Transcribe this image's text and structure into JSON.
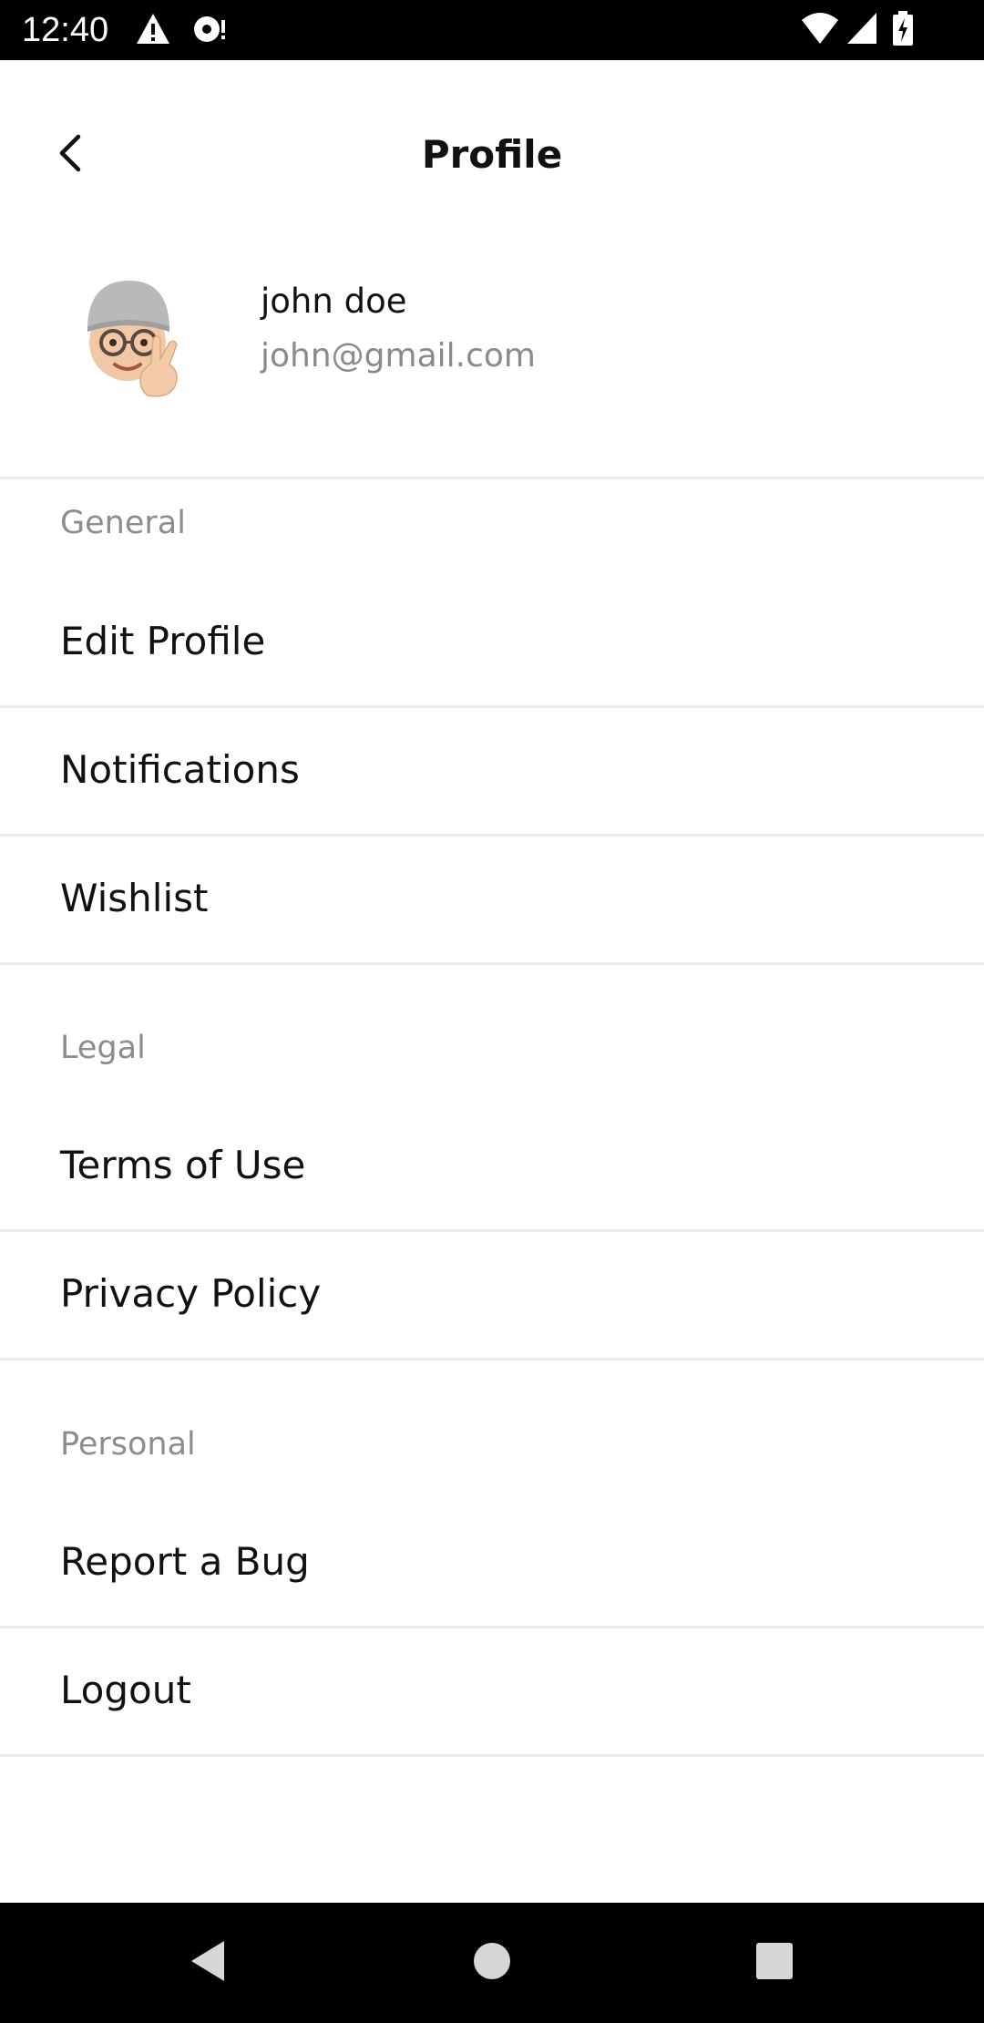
{
  "status_bar": {
    "time": "12:40",
    "icons": [
      "warning-icon",
      "media-icon",
      "wifi-icon",
      "signal-icon",
      "battery-charging-icon"
    ]
  },
  "app_bar": {
    "title": "Profile",
    "back_icon": "chevron-left-icon"
  },
  "profile": {
    "name": "john doe",
    "email": "john@gmail.com",
    "avatar_icon": "memoji-avatar"
  },
  "sections": [
    {
      "label": "General",
      "items": [
        "Edit Profile",
        "Notifications",
        "Wishlist"
      ]
    },
    {
      "label": "Legal",
      "items": [
        "Terms of Use",
        "Privacy Policy"
      ]
    },
    {
      "label": "Personal",
      "items": [
        "Report a Bug",
        "Logout"
      ]
    }
  ],
  "nav_bar": {
    "buttons": [
      "back-triangle-icon",
      "home-circle-icon",
      "recents-square-icon"
    ]
  },
  "colors": {
    "divider": "#ececec",
    "secondary_text": "#8a8a8a",
    "primary_text": "#111111"
  }
}
